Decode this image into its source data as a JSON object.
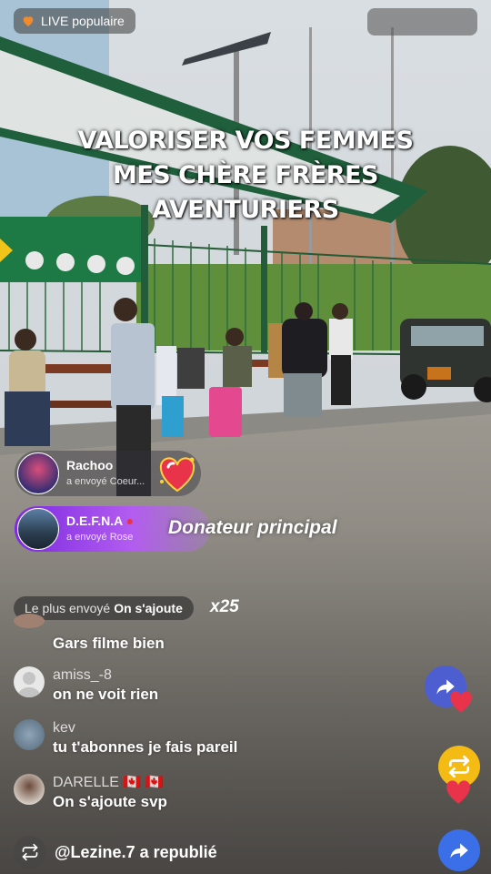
{
  "live_badge": {
    "label": "LIVE populaire",
    "icon": "heart-icon",
    "color": "#f08a2a"
  },
  "overlay_title": "VALORISER VOS FEMMES MES CHÈRE FRÈRES AVENTURIERS",
  "gifts": [
    {
      "user": "Rachoo",
      "sent": "a envoyé",
      "item": "Coeur..."
    },
    {
      "user": "D.E.F.N.A",
      "sent": "a envoyé",
      "item": "Rose"
    }
  ],
  "top_donor_label": "Donateur principal",
  "most_sent": {
    "label": "Le plus envoyé",
    "value": "On s'ajoute",
    "count": "x25"
  },
  "comments": [
    {
      "name": "",
      "text": "Gars filme bien"
    },
    {
      "name": "amiss_-8",
      "text": "on ne voit rien"
    },
    {
      "name": "kev",
      "text": "tu t'abonnes je fais pareil"
    },
    {
      "name": "DARELLE 🇨🇦 🇨🇦",
      "text": "On s'ajoute svp"
    }
  ],
  "republish": {
    "user": "@Lezine.7",
    "action": "a republié"
  },
  "colors": {
    "accent_purple": "#7b2ae0",
    "repost_yellow": "#f3bb14",
    "share_blue": "#3a6fe8",
    "heart_red": "#e8334a"
  }
}
